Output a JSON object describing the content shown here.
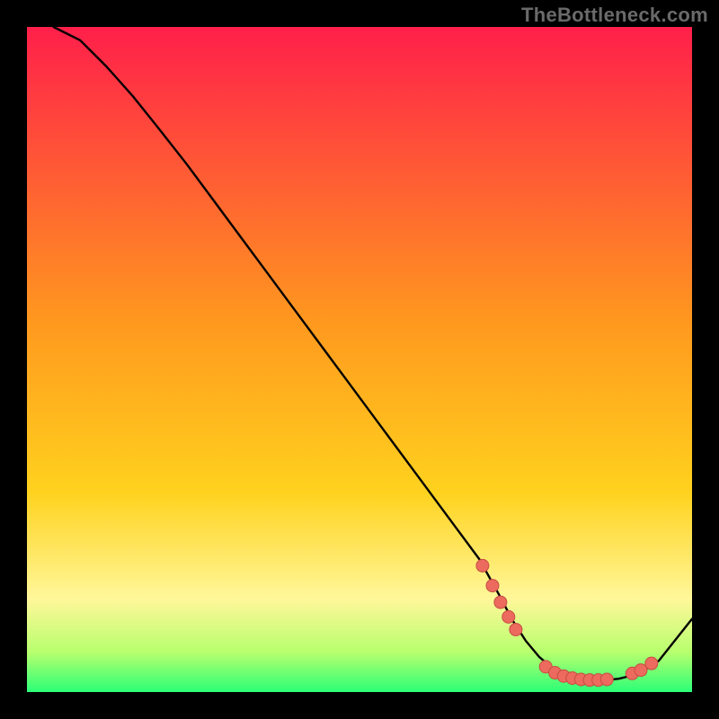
{
  "attribution": "TheBottleneck.com",
  "colors": {
    "frame": "#000000",
    "curve": "#000000",
    "dot_fill": "#ec6a5e",
    "dot_stroke": "#c84d42",
    "grad_top": "#ff1f4a",
    "grad_mid1": "#ff6a2a",
    "grad_mid2": "#ffd21e",
    "grad_mid3": "#fff79a",
    "grad_bottom1": "#b8ff6e",
    "grad_bottom2": "#2bff77"
  },
  "chart_data": {
    "type": "line",
    "title": "",
    "xlabel": "",
    "ylabel": "",
    "xlim": [
      0,
      100
    ],
    "ylim": [
      0,
      100
    ],
    "x": [
      4,
      8,
      12,
      16,
      20,
      24,
      28,
      32,
      36,
      40,
      44,
      48,
      52,
      56,
      60,
      64,
      68,
      71,
      73,
      75,
      77,
      79,
      81,
      83,
      85,
      87,
      89,
      91,
      93,
      95,
      100
    ],
    "values": [
      100,
      98,
      94,
      89.5,
      84.5,
      79.4,
      74,
      68.6,
      63.2,
      57.8,
      52.4,
      47,
      41.6,
      36.2,
      30.8,
      25.4,
      20,
      14.6,
      10.8,
      7.7,
      5.3,
      3.6,
      2.5,
      2.0,
      1.8,
      1.8,
      2.0,
      2.5,
      3.4,
      4.7,
      11
    ],
    "dot_points_x": [
      68.5,
      70.0,
      71.2,
      72.4,
      73.5,
      78.0,
      79.4,
      80.7,
      82.0,
      83.3,
      84.6,
      85.9,
      87.2,
      91.0,
      92.3,
      93.9
    ],
    "dot_points_y": [
      19.0,
      16.0,
      13.5,
      11.3,
      9.4,
      3.8,
      2.9,
      2.4,
      2.1,
      1.9,
      1.8,
      1.8,
      1.9,
      2.8,
      3.3,
      4.3
    ]
  }
}
